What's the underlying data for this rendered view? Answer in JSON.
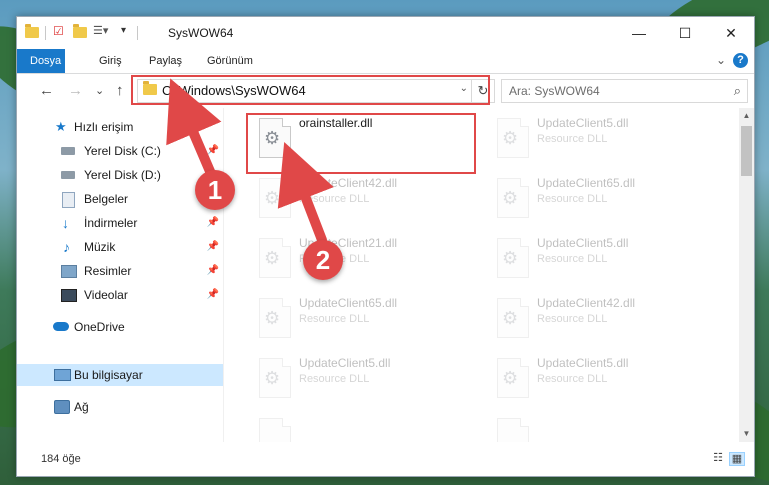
{
  "window": {
    "title": "SysWOW64",
    "controls": {
      "minimize": "—",
      "maximize": "☐",
      "close": "✕"
    }
  },
  "ribbon": {
    "tabs": [
      "Dosya",
      "Giriş",
      "Paylaş",
      "Görünüm"
    ],
    "expand": "⌄",
    "help": "?"
  },
  "nav": {
    "back": "←",
    "forward": "→",
    "recent": "⌄",
    "up": "↑",
    "address": "C:\\Windows\\SysWOW64",
    "address_drop": "⌄",
    "refresh": "↻",
    "search_placeholder": "Ara: SysWOW64",
    "search_icon": "⌕"
  },
  "sidebar": {
    "items": [
      {
        "label": "Hızlı erişim",
        "icon": "star-icon"
      },
      {
        "label": "Yerel Disk (C:)",
        "icon": "drive-icon",
        "pinned": true
      },
      {
        "label": "Yerel Disk (D:)",
        "icon": "drive-icon"
      },
      {
        "label": "Belgeler",
        "icon": "documents-icon",
        "pinned": true
      },
      {
        "label": "İndirmeler",
        "icon": "download-icon",
        "pinned": true
      },
      {
        "label": "Müzik",
        "icon": "music-icon",
        "pinned": true
      },
      {
        "label": "Resimler",
        "icon": "pictures-icon",
        "pinned": true
      },
      {
        "label": "Videolar",
        "icon": "videos-icon",
        "pinned": true
      },
      {
        "label": "OneDrive",
        "icon": "cloud-icon"
      },
      {
        "label": "Bu bilgisayar",
        "icon": "computer-icon",
        "selected": true
      },
      {
        "label": "Ağ",
        "icon": "network-icon"
      }
    ]
  },
  "files": [
    {
      "name": "orainstaller.dll",
      "type": ""
    },
    {
      "name": "UpdateClient5.dll",
      "type": "Resource DLL"
    },
    {
      "name": "UpdateClient42.dll",
      "type": "Resource DLL"
    },
    {
      "name": "UpdateClient65.dll",
      "type": "Resource DLL"
    },
    {
      "name": "UpdateClient21.dll",
      "type": "Resource DLL"
    },
    {
      "name": "UpdateClient5.dll",
      "type": "Resource DLL"
    },
    {
      "name": "UpdateClient65.dll",
      "type": "Resource DLL"
    },
    {
      "name": "UpdateClient42.dll",
      "type": "Resource DLL"
    },
    {
      "name": "UpdateClient5.dll",
      "type": "Resource DLL"
    },
    {
      "name": "UpdateClient5.dll",
      "type": "Resource DLL"
    }
  ],
  "status": {
    "count": "184 öğe"
  },
  "annotations": {
    "step1": "1",
    "step2": "2",
    "color": "#e04848"
  },
  "colors": {
    "accent": "#1979ca",
    "selection": "#cce8ff",
    "folder": "#f0c94a"
  }
}
